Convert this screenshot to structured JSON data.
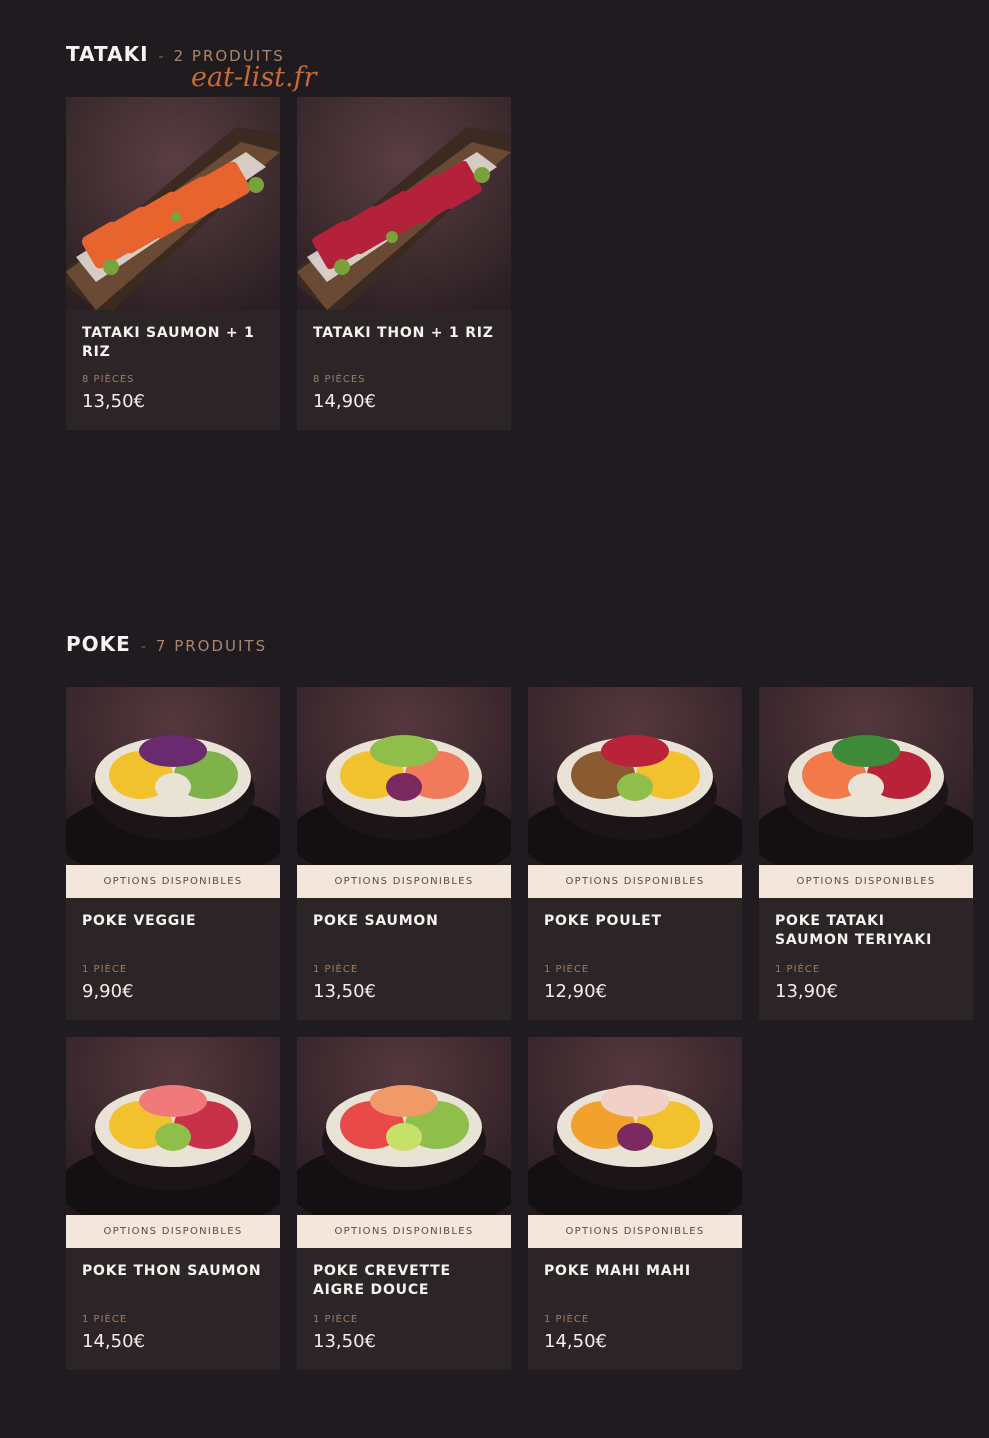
{
  "watermark": "eat-list.fr",
  "sections": [
    {
      "title": "TATAKI",
      "separator": "-",
      "count_label": "2 PRODUITS",
      "items": [
        {
          "name": "TATAKI SAUMON + 1 RIZ",
          "quantity": "8 PIÈCES",
          "price": "13,50€"
        },
        {
          "name": "TATAKI THON + 1 RIZ",
          "quantity": "8 PIÈCES",
          "price": "14,90€"
        }
      ]
    },
    {
      "title": "POKE",
      "separator": "-",
      "count_label": "7 PRODUITS",
      "options_label": "OPTIONS DISPONIBLES",
      "items": [
        {
          "name": "POKE VEGGIE",
          "quantity": "1 PIÈCE",
          "price": "9,90€"
        },
        {
          "name": "POKE SAUMON",
          "quantity": "1 PIÈCE",
          "price": "13,50€"
        },
        {
          "name": "POKE POULET",
          "quantity": "1 PIÈCE",
          "price": "12,90€"
        },
        {
          "name": "POKE TATAKI SAUMON TERIYAKI",
          "quantity": "1 PIÈCE",
          "price": "13,90€"
        },
        {
          "name": "POKE THON SAUMON",
          "quantity": "1 PIÈCE",
          "price": "14,50€"
        },
        {
          "name": "POKE CREVETTE AIGRE DOUCE",
          "quantity": "1 PIÈCE",
          "price": "13,50€"
        },
        {
          "name": "POKE MAHI MAHI",
          "quantity": "1 PIÈCE",
          "price": "14,50€"
        }
      ]
    }
  ],
  "colors": {
    "background": "#201b1e",
    "card": "#2b2528",
    "badge": "#f3e7dc",
    "accent": "#c56b3a"
  }
}
